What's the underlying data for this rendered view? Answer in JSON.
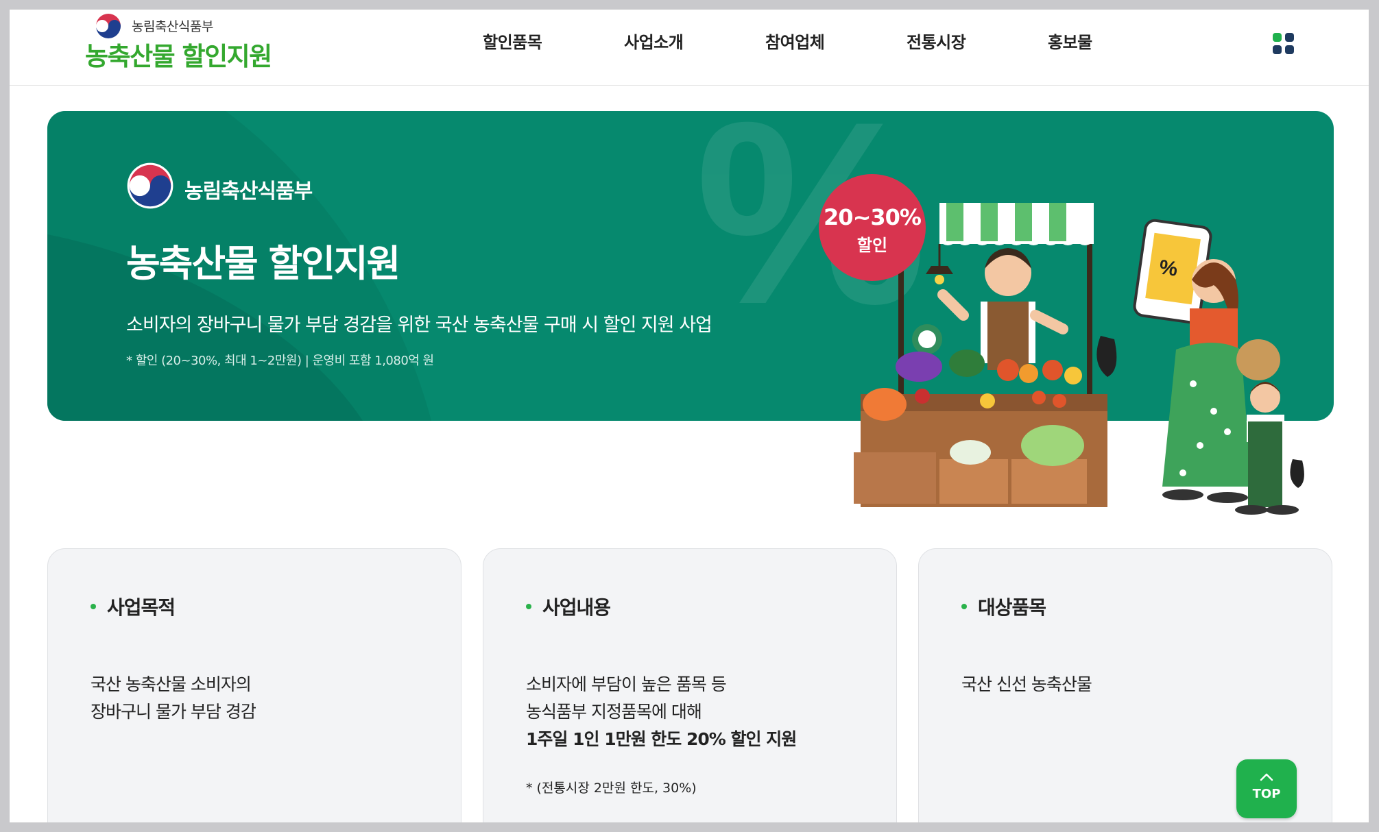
{
  "header": {
    "ministry": "농림축산식품부",
    "site_title": "농축산물 할인지원",
    "nav": [
      "할인품목",
      "사업소개",
      "참여업체",
      "전통시장",
      "홍보물"
    ],
    "menu_icon": "grid-menu-icon"
  },
  "banner": {
    "ministry": "농림축산식품부",
    "title": "농축산물 할인지원",
    "description": "소비자의 장바구니 물가 부담 경감을 위한 국산 농축산물 구매 시 할인 지원 사업",
    "note": "* 할인 (20~30%, 최대 1~2만원)  |  운영비 포함 1,080억 원",
    "badge_pct": "20~30%",
    "badge_label": "할인"
  },
  "cards": [
    {
      "title": "사업목적",
      "lines": [
        "국산 농축산물 소비자의",
        "장바구니 물가 부담 경감"
      ]
    },
    {
      "title": "사업내용",
      "lines": [
        "소비자에 부담이 높은 품목 등",
        "농식품부 지정품목에 대해"
      ],
      "highlight": "1주일 1인 1만원 한도 20% 할인 지원",
      "small_note": "* (전통시장 2만원 한도, 30%)"
    },
    {
      "title": "대상품목",
      "lines": [
        "국산 신선 농축산물"
      ]
    }
  ],
  "top_button": {
    "label": "TOP"
  },
  "colors": {
    "brand_green": "#34a82f",
    "banner_bg": "#06896e",
    "badge_red": "#d8344f",
    "top_button": "#20b14d"
  }
}
